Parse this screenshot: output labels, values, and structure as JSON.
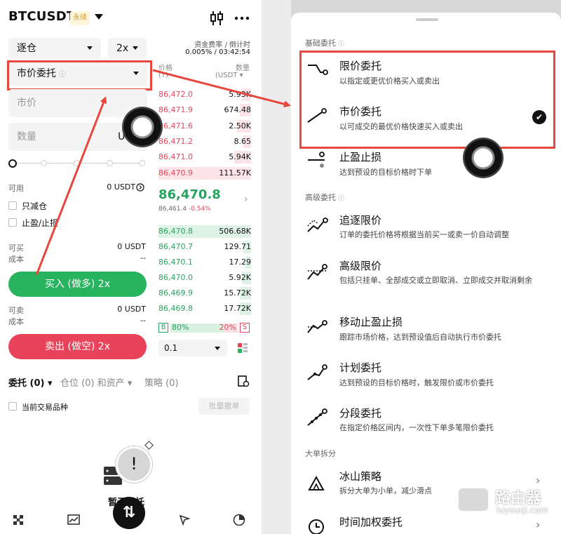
{
  "left": {
    "symbol": "BTCUSDT",
    "perp_badge": "永续",
    "margin_mode": "逐仓",
    "leverage": "2x",
    "funding_label": "资金费率 / 倒计时",
    "funding_value": "0.005% / 03:42:54",
    "order_type": "市价委托",
    "price_placeholder": "市价",
    "qty_placeholder": "数量",
    "qty_unit": "USD",
    "available_label": "可用",
    "available_value": "0 USDT",
    "reduce_only": "只减仓",
    "tp_sl": "止盈/止损",
    "can_buy_label": "可买",
    "can_buy_value": "0 USDT",
    "cost_label": "成本",
    "cost_value": "--",
    "buy_button": "买入 (做多) 2x",
    "can_sell_label": "可卖",
    "can_sell_value": "0 USDT",
    "cost2_label": "成本",
    "cost2_value": "--",
    "sell_button": "卖出 (做空) 2x",
    "tabs": [
      "委托 (0)",
      "仓位 (0) 和资产",
      "策略 (0)"
    ],
    "current_only": "当前交易品种",
    "batch_cancel": "批量撤单",
    "empty_text": "暂无委托"
  },
  "orderbook": {
    "price_header": "价格",
    "price_unit": "(T)",
    "qty_header": "数量",
    "qty_unit": "(USDT",
    "asks": [
      {
        "price": "86,472.0",
        "qty": "5.93K",
        "depth": 0.1
      },
      {
        "price": "86,471.9",
        "qty": "674.48",
        "depth": 0.12
      },
      {
        "price": "86,471.6",
        "qty": "2.50K",
        "depth": 0.15
      },
      {
        "price": "86,471.2",
        "qty": "8.65",
        "depth": 0.08
      },
      {
        "price": "86,471.0",
        "qty": "5.94K",
        "depth": 0.18
      },
      {
        "price": "86,470.9",
        "qty": "111.57K",
        "depth": 1.0
      }
    ],
    "last_price": "86,470.8",
    "last_sub": "86,461.4",
    "last_change": "-0.54%",
    "bids": [
      {
        "price": "86,470.8",
        "qty": "506.68K",
        "depth": 1.0
      },
      {
        "price": "86,470.7",
        "qty": "129.71",
        "depth": 0.08
      },
      {
        "price": "86,470.1",
        "qty": "17.29",
        "depth": 0.06
      },
      {
        "price": "86,470.0",
        "qty": "5.92K",
        "depth": 0.1
      },
      {
        "price": "86,469.9",
        "qty": "15.72K",
        "depth": 0.12
      },
      {
        "price": "86,469.8",
        "qty": "17.72K",
        "depth": 0.12
      }
    ],
    "buy_ratio": "80%",
    "sell_ratio": "20%",
    "b_label": "B",
    "s_label": "S",
    "precision": "0.1"
  },
  "right": {
    "basic_section": "基础委托",
    "advanced_section": "高级委托",
    "large_section": "大单拆分",
    "items": [
      {
        "title": "限价委托",
        "desc": "以指定或更优价格买入或卖出"
      },
      {
        "title": "市价委托",
        "desc": "以可成交的最优价格快速买入或卖出"
      },
      {
        "title": "止盈止损",
        "desc": "达到预设的目标价格时下单"
      },
      {
        "title": "追逐限价",
        "desc": "订单的委托价格将根据当前买一或卖一价自动调整"
      },
      {
        "title": "高级限价",
        "desc": "包括只挂单、全部成交或立即取消、立即成交并取消剩余"
      },
      {
        "title": "移动止盈止损",
        "desc": "跟踪市场价格，达到预设值后自动执行市价委托"
      },
      {
        "title": "计划委托",
        "desc": "达到预设的目标价格时，触发限价或市价委托"
      },
      {
        "title": "分段委托",
        "desc": "在指定价格区间内，一次性下单多笔限价委托"
      },
      {
        "title": "冰山策略",
        "desc": "拆分大单为小单，减少滑点"
      },
      {
        "title": "时间加权委托",
        "desc": ""
      }
    ],
    "watermark_name": "路由器",
    "watermark_url": "luyouqi.com"
  },
  "colors": {
    "buy": "#28b35f",
    "sell": "#e8435a",
    "highlight": "#e8473d"
  }
}
